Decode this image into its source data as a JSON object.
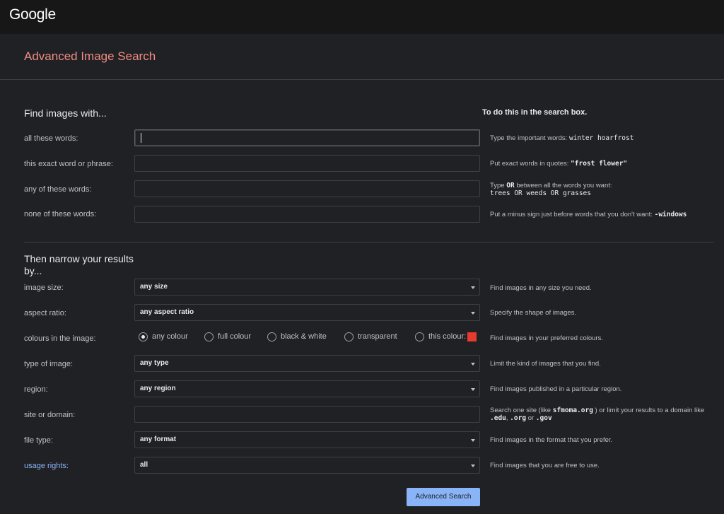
{
  "header": {
    "logo": "Google"
  },
  "page": {
    "title": "Advanced Image Search"
  },
  "find": {
    "heading": "Find images with...",
    "hint_heading": "To do this in the search box.",
    "rows": [
      {
        "label": "all these words:",
        "value": "",
        "hint_text": "Type the important words: ",
        "hint_code": "winter hoarfrost"
      },
      {
        "label": "this exact word or phrase:",
        "value": "",
        "hint_text": "Put exact words in quotes: ",
        "hint_code": "\"frost flower\""
      },
      {
        "label": "any of these words:",
        "value": "",
        "hint_text_1": "Type ",
        "hint_or": "OR",
        "hint_text_2": " between all the words you want:",
        "hint_code": "trees OR weeds OR grasses"
      },
      {
        "label": "none of these words:",
        "value": "",
        "hint_text": "Put a minus sign just before words that you don't want: ",
        "hint_code": "-windows"
      }
    ]
  },
  "narrow": {
    "heading_line1": "Then narrow your results",
    "heading_line2": "by...",
    "image_size": {
      "label": "image size:",
      "selected": "any size",
      "hint": "Find images in any size you need."
    },
    "aspect_ratio": {
      "label": "aspect ratio:",
      "selected": "any aspect ratio",
      "hint": "Specify the shape of images."
    },
    "colours": {
      "label": "colours in the image:",
      "options": [
        "any colour",
        "full colour",
        "black & white",
        "transparent",
        "this colour:"
      ],
      "selected_index": 0,
      "swatch_color": "#e63b2e",
      "hint": "Find images in your preferred colours."
    },
    "type": {
      "label": "type of image:",
      "selected": "any type",
      "hint": "Limit the kind of images that you find."
    },
    "region": {
      "label": "region:",
      "selected": "any region",
      "hint": "Find images published in a particular region."
    },
    "site": {
      "label": "site or domain:",
      "value": "",
      "hint_1": "Search one site (like ",
      "hint_code_1": "sfmoma.org",
      "hint_2": " ) or limit your results to a domain like",
      "hint_code_2": ".edu",
      "hint_3": ", ",
      "hint_code_3": ".org",
      "hint_4": " or ",
      "hint_code_4": ".gov"
    },
    "file_type": {
      "label": "file type:",
      "selected": "any format",
      "hint": "Find images in the format that you prefer."
    },
    "usage": {
      "label": "usage rights:",
      "selected": "all",
      "hint": "Find images that you are free to use."
    }
  },
  "actions": {
    "submit_label": "Advanced Search"
  },
  "colors": {
    "accent_title": "#f28b82",
    "link": "#8ab4f8",
    "button": "#8ab4f8",
    "background": "#202124",
    "topbar": "#171717"
  }
}
